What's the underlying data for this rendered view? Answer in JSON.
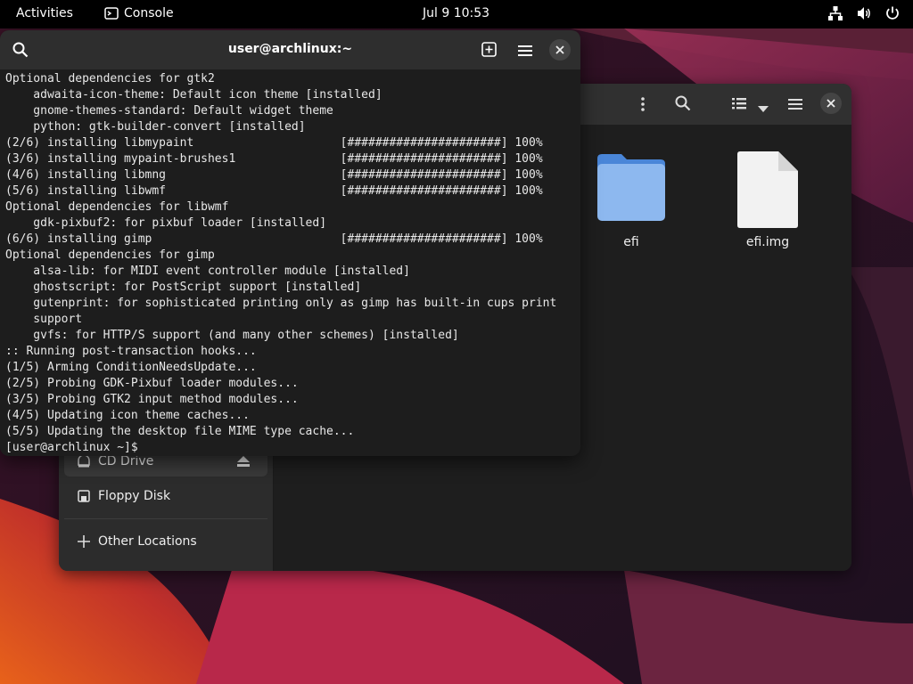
{
  "top_bar": {
    "activities": "Activities",
    "app_name": "Console",
    "clock": "Jul 9  10:53",
    "tray_icons": [
      "network-icon",
      "volume-icon",
      "power-icon"
    ]
  },
  "terminal": {
    "title": "user@archlinux:~",
    "lines": [
      "Optional dependencies for gtk2",
      "    adwaita-icon-theme: Default icon theme [installed]",
      "    gnome-themes-standard: Default widget theme",
      "    python: gtk-builder-convert [installed]",
      "(2/6) installing libmypaint                     [######################] 100%",
      "(3/6) installing mypaint-brushes1               [######################] 100%",
      "(4/6) installing libmng                         [######################] 100%",
      "(5/6) installing libwmf                         [######################] 100%",
      "Optional dependencies for libwmf",
      "    gdk-pixbuf2: for pixbuf loader [installed]",
      "(6/6) installing gimp                           [######################] 100%",
      "Optional dependencies for gimp",
      "    alsa-lib: for MIDI event controller module [installed]",
      "    ghostscript: for PostScript support [installed]",
      "    gutenprint: for sophisticated printing only as gimp has built-in cups print",
      "    support",
      "    gvfs: for HTTP/S support (and many other schemes) [installed]",
      ":: Running post-transaction hooks...",
      "(1/5) Arming ConditionNeedsUpdate...",
      "(2/5) Probing GDK-Pixbuf loader modules...",
      "(3/5) Probing GTK2 input method modules...",
      "(4/5) Updating icon theme caches...",
      "(5/5) Updating the desktop file MIME type cache...",
      "[user@archlinux ~]$ "
    ]
  },
  "files": {
    "sidebar": {
      "cd_drive": "CD Drive",
      "floppy": "Floppy Disk",
      "other_locations": "Other Locations"
    },
    "items": [
      {
        "name": "efi",
        "type": "folder"
      },
      {
        "name": "efi.img",
        "type": "file"
      }
    ]
  },
  "colors": {
    "folder": "#6fa3e6",
    "folder_tab": "#4a86d8",
    "wallpaper_dark": "#2a1420",
    "wallpaper_orange": "#e0641e"
  }
}
